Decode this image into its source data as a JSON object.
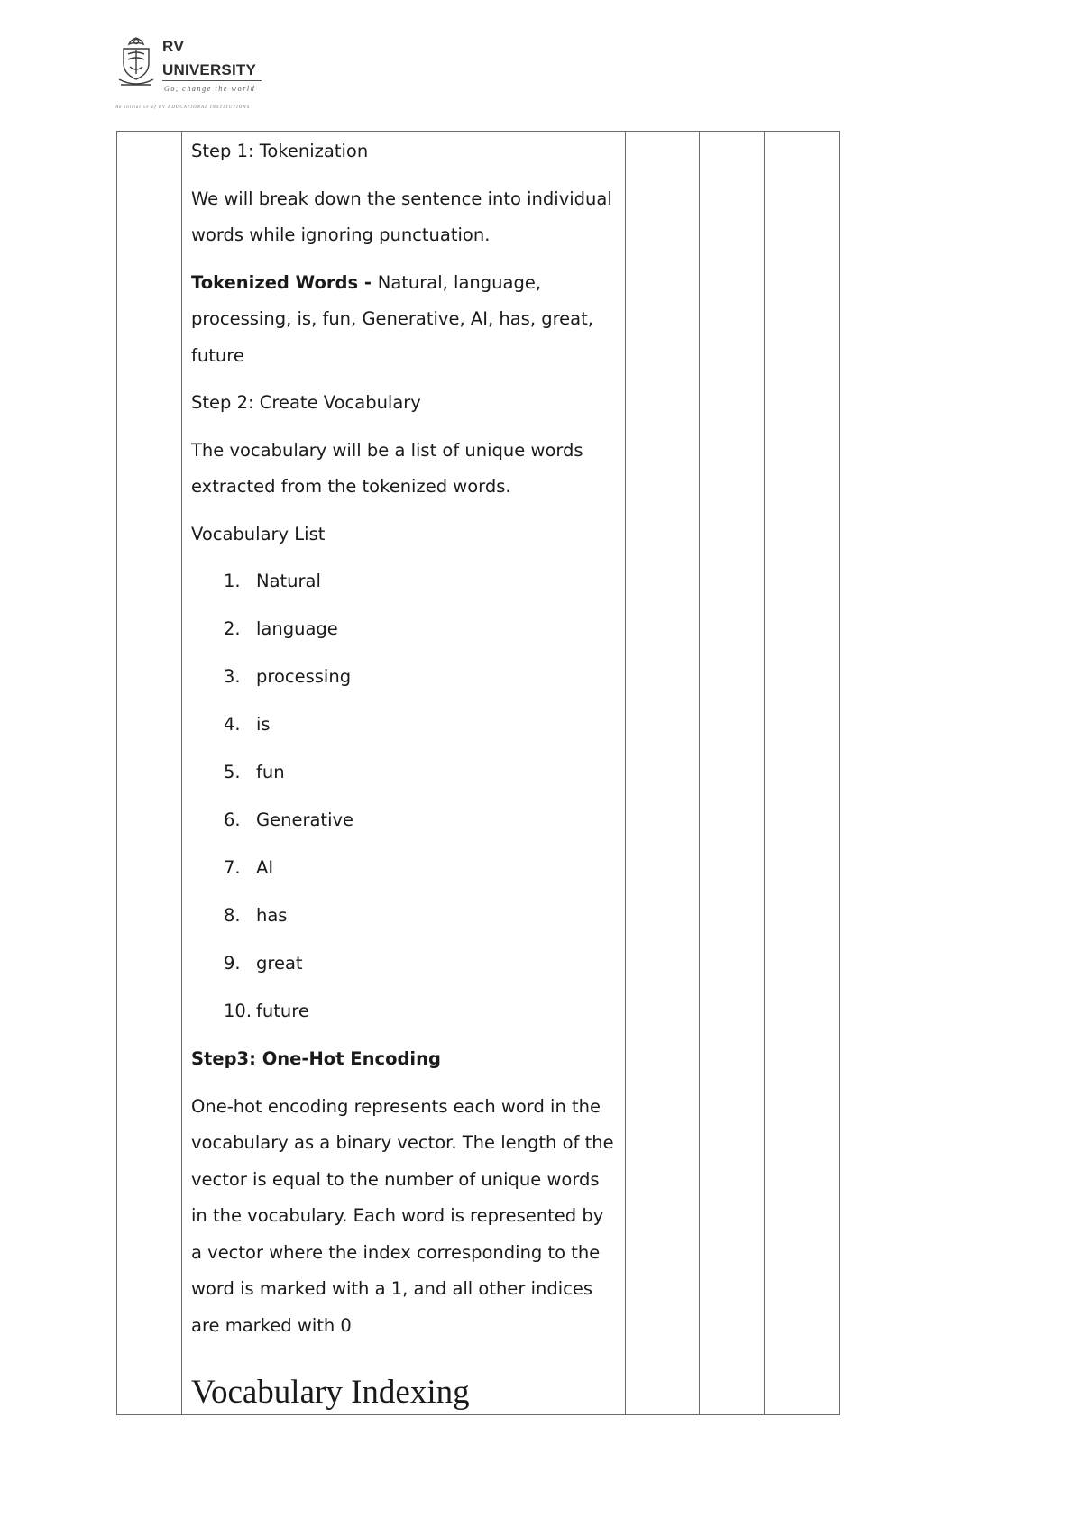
{
  "header": {
    "logo_word1": "RV",
    "logo_word2": "UNIVERSITY",
    "logo_tagline": "Go, change the world",
    "logo_initiative": "An initiative of RV EDUCATIONAL INSTITUTIONS"
  },
  "content": {
    "step1_title": "Step 1: Tokenization",
    "step1_desc": "We will break down the sentence into individual words while ignoring punctuation.",
    "tokenized_label": "Tokenized Words - ",
    "tokenized_value": "Natural, language, processing, is, fun, Generative, AI, has, great, future",
    "step2_title": "Step 2: Create Vocabulary",
    "step2_desc": "The vocabulary will be a list of unique words extracted from the tokenized words.",
    "vocab_list_title": "Vocabulary List",
    "vocab_items": [
      {
        "num": "1.",
        "word": "Natural"
      },
      {
        "num": "2.",
        "word": "language"
      },
      {
        "num": "3.",
        "word": "processing"
      },
      {
        "num": "4.",
        "word": "is"
      },
      {
        "num": "5.",
        "word": "fun"
      },
      {
        "num": "6.",
        "word": "Generative"
      },
      {
        "num": "7.",
        "word": "AI"
      },
      {
        "num": "8.",
        "word": "has"
      },
      {
        "num": "9.",
        "word": "great"
      },
      {
        "num": "10.",
        "word": "future"
      }
    ],
    "step3_title": "Step3: One-Hot Encoding",
    "step3_desc": "One-hot encoding represents each word in the vocabulary as a binary vector. The length of the vector is equal to the number of unique words in the vocabulary. Each word is represented by a vector where the index corresponding to the word is marked with a 1, and all other indices are marked with 0",
    "vocab_indexing_heading": "Vocabulary Indexing"
  }
}
